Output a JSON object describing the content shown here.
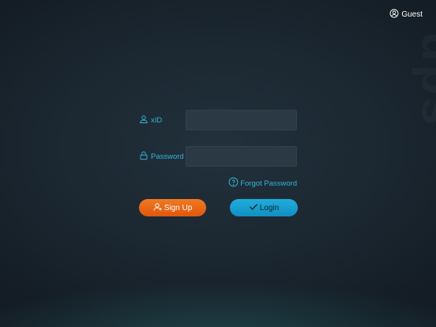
{
  "header": {
    "guest_label": "Guest",
    "guest_icon": "user-circle-icon"
  },
  "form": {
    "xid_label": "xID",
    "xid_icon": "user-outline-icon",
    "xid_value": "",
    "password_label": "Password",
    "password_icon": "lock-icon",
    "password_value": "",
    "forgot_label": "Forgot Password",
    "forgot_icon": "question-circle-icon"
  },
  "actions": {
    "signup_label": "Sign Up",
    "signup_icon": "add-user-icon",
    "login_label": "Login",
    "login_icon": "checkmark-icon"
  },
  "colors": {
    "accent": "#33b5d8",
    "signup_button": "#e9661a",
    "login_button": "#18a1d1",
    "background": "#1b2731"
  }
}
